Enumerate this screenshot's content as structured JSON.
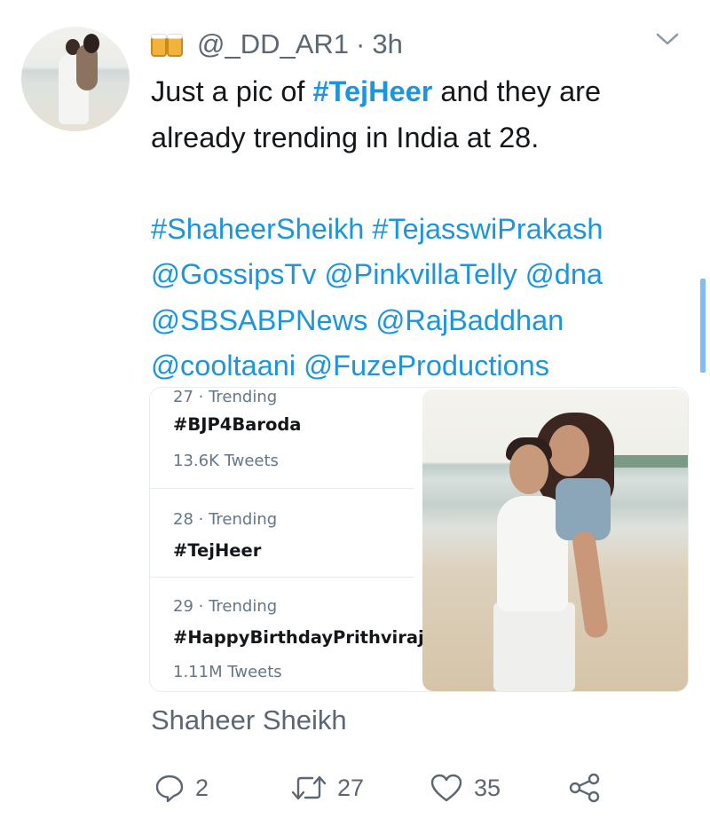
{
  "tweet": {
    "handle": "@_DD_AR1",
    "separator": "·",
    "time": "3h",
    "author_emoji": "beer-mugs-icon",
    "text": {
      "line1_prefix": "Just a pic of ",
      "line1_tag": "#TejHeer",
      "line1_suffix": " and they are",
      "line2": "already trending in India at 28.",
      "tags_line1": "#ShaheerSheikh #TejasswiPrakash",
      "tags_line2": "@GossipsTv @PinkvillaTelly @dna",
      "tags_line3": "@SBSABPNews @RajBaddhan",
      "tags_line4": "@cooltaani @FuzeProductions"
    },
    "caption": "Shaheer Sheikh",
    "actions": {
      "replies": "2",
      "retweets": "27",
      "likes": "35"
    }
  },
  "trends": [
    {
      "meta": "27 · Trending",
      "name": "#BJP4Baroda",
      "count": "13.6K Tweets"
    },
    {
      "meta": "28 · Trending",
      "name": "#TejHeer",
      "count": ""
    },
    {
      "meta": "29 · Trending",
      "name": "#HappyBirthdayPrithviraj",
      "count": "1.11M Tweets"
    }
  ],
  "colors": {
    "link": "#1b95e0",
    "secondary_text": "#5b6772",
    "border": "#e6ecf0"
  }
}
